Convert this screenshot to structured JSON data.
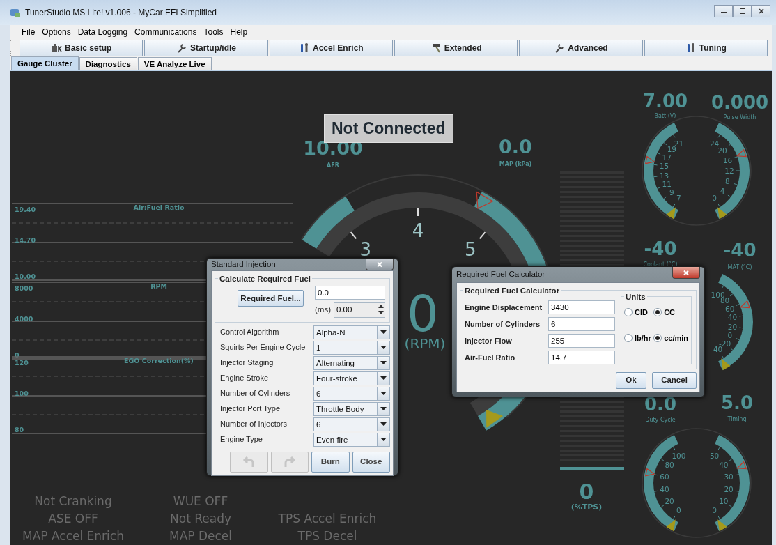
{
  "window": {
    "title": "TunerStudio MS Lite! v1.006 - MyCar EFI Simplified"
  },
  "menu": [
    "File",
    "Options",
    "Data Logging",
    "Communications",
    "Tools",
    "Help"
  ],
  "toolbar": [
    "Basic setup",
    "Startup/idle",
    "Accel Enrich",
    "Extended",
    "Advanced",
    "Tuning"
  ],
  "tabs": [
    {
      "label": "Gauge Cluster",
      "selected": true
    },
    {
      "label": "Diagnostics",
      "selected": false
    },
    {
      "label": "VE Analyze Live",
      "selected": false
    }
  ],
  "dashboard": {
    "status": "Not Connected",
    "strip_charts": [
      {
        "title": "Air:Fuel Ratio",
        "ticks": [
          "19.40",
          "14.70",
          "10.00"
        ]
      },
      {
        "title": "RPM",
        "ticks": [
          "8000",
          "4000",
          "0"
        ]
      },
      {
        "title": "EGO Correction(%)",
        "ticks": [
          "120",
          "100",
          "80"
        ]
      }
    ],
    "rpm_gauge": {
      "value": "0",
      "label": "(RPM)",
      "ticks": [
        "3",
        "4",
        "5"
      ]
    },
    "readouts": [
      {
        "value": "10.00",
        "label": "AFR"
      },
      {
        "value": "0.0",
        "label": "MAP (kPa)"
      }
    ],
    "tps": {
      "value": "0",
      "label": "(%TPS)"
    },
    "round_gauges": [
      {
        "value": "7.00",
        "label": "Batt (V)",
        "ticks": [
          "21",
          "19",
          "17",
          "15",
          "13",
          "11",
          "9",
          "7"
        ]
      },
      {
        "value": "0.000",
        "label": "Pulse Width",
        "ticks": [
          "24",
          "20",
          "16",
          "12",
          "8",
          "4",
          "0"
        ]
      },
      {
        "value": "-40",
        "label": "Coolant (°C)"
      },
      {
        "value": "-40",
        "label": "MAT (°C)",
        "ticks": [
          "100",
          "80",
          "60",
          "40",
          "20",
          "0",
          "-20",
          "40"
        ]
      },
      {
        "value": "0.0",
        "label": "Duty Cycle",
        "ticks": [
          "100",
          "80",
          "60",
          "40",
          "20",
          "0"
        ]
      },
      {
        "value": "5.0",
        "label": "Timing",
        "ticks": [
          "50",
          "40",
          "30",
          "20",
          "10",
          "0"
        ]
      }
    ],
    "indicators": [
      {
        "items": [
          {
            "text": "Not Cranking",
            "on": false
          },
          {
            "text": "ASE OFF",
            "on": false
          },
          {
            "text": "MAP Accel Enrich",
            "on": false
          }
        ]
      },
      {
        "items": [
          {
            "text": "WUE OFF",
            "on": false
          },
          {
            "text": "Not Ready",
            "on": false
          },
          {
            "text": "MAP Decel",
            "on": false
          }
        ]
      },
      {
        "items": [
          {
            "text": "TPS Accel Enrich",
            "on": false
          },
          {
            "text": "TPS Decel",
            "on": false
          }
        ]
      }
    ]
  },
  "injection_dialog": {
    "title": "Standard Injection",
    "group": "Calculate Required Fuel",
    "calc_button": "Required Fuel...",
    "value": "0.0",
    "unit": "(ms)",
    "spinner_value": "0.00",
    "rows": [
      {
        "label": "Control Algorithm",
        "value": "Alpha-N"
      },
      {
        "label": "Squirts Per Engine Cycle",
        "value": "1"
      },
      {
        "label": "Injector Staging",
        "value": "Alternating"
      },
      {
        "label": "Engine Stroke",
        "value": "Four-stroke"
      },
      {
        "label": "Number of Cylinders",
        "value": "6"
      },
      {
        "label": "Injector Port Type",
        "value": "Throttle Body"
      },
      {
        "label": "Number of Injectors",
        "value": "6"
      },
      {
        "label": "Engine Type",
        "value": "Even fire"
      }
    ],
    "buttons": [
      {
        "kind": "undo",
        "disabled": true
      },
      {
        "kind": "redo",
        "disabled": true
      },
      {
        "kind": "text",
        "label": "Burn",
        "disabled": false
      },
      {
        "kind": "text",
        "label": "Close",
        "disabled": false
      }
    ]
  },
  "calculator_dialog": {
    "title": "Required Fuel Calculator",
    "group": "Required Fuel Calculator",
    "fields": [
      {
        "label": "Engine Displacement",
        "value": "3430"
      },
      {
        "label": "Number of Cylinders",
        "value": "6"
      },
      {
        "label": "Injector Flow",
        "value": "255"
      },
      {
        "label": "Air-Fuel Ratio",
        "value": "14.7"
      }
    ],
    "units_title": "Units",
    "units": [
      {
        "label": "CID",
        "selected": false
      },
      {
        "label": "CC",
        "selected": true
      },
      {
        "label": "lb/hr",
        "selected": false
      },
      {
        "label": "cc/min",
        "selected": true
      }
    ],
    "buttons": [
      "Ok",
      "Cancel"
    ]
  }
}
